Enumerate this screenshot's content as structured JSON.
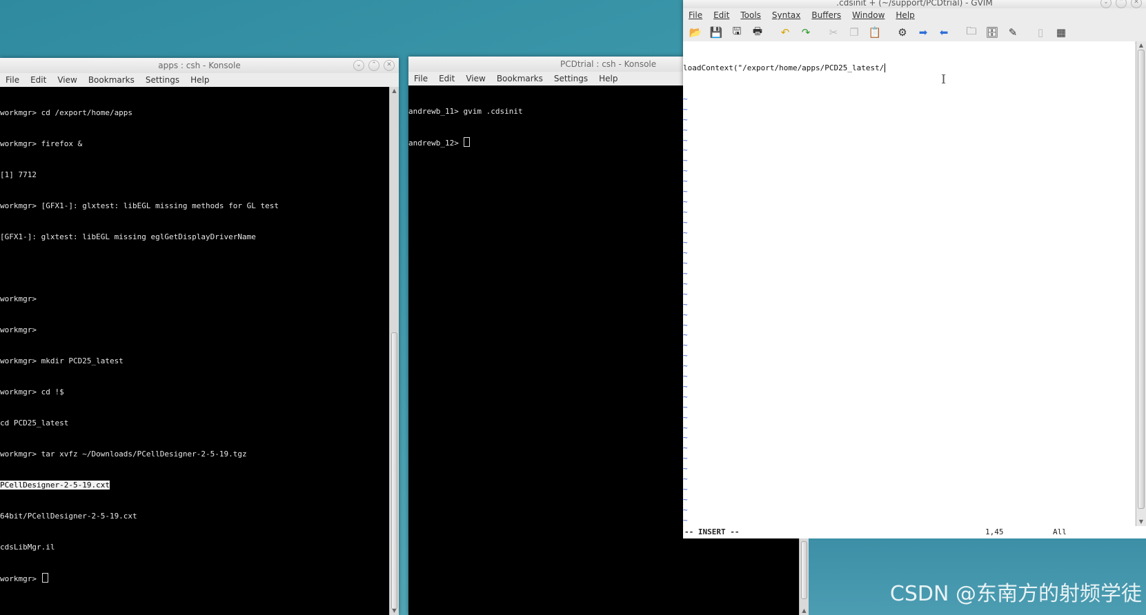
{
  "konsole_left": {
    "title": "apps : csh - Konsole",
    "menu": [
      "File",
      "Edit",
      "View",
      "Bookmarks",
      "Settings",
      "Help"
    ],
    "lines": [
      "workmgr> cd /export/home/apps",
      "workmgr> firefox &",
      "[1] 7712",
      "workmgr> [GFX1-]: glxtest: libEGL missing methods for GL test",
      "[GFX1-]: glxtest: libEGL missing eglGetDisplayDriverName",
      "",
      "workmgr>",
      "workmgr>",
      "workmgr> mkdir PCD25_latest",
      "workmgr> cd !$",
      "cd PCD25_latest",
      "workmgr> tar xvfz ~/Downloads/PCellDesigner-2-5-19.tgz"
    ],
    "selected_line": "PCellDesigner-2-5-19.cxt",
    "lines_after": [
      "64bit/PCellDesigner-2-5-19.cxt",
      "cdsLibMgr.il"
    ],
    "prompt": "workmgr> "
  },
  "konsole_middle": {
    "title": "PCDtrial : csh - Konsole",
    "menu": [
      "File",
      "Edit",
      "View",
      "Bookmarks",
      "Settings",
      "Help"
    ],
    "lines": [
      "andrewb_11> gvim .cdsinit"
    ],
    "prompt": "andrewb_12> "
  },
  "gvim": {
    "title": ".cdsinit + (~/support/PCDtrial) - GVIM",
    "menu": [
      "File",
      "Edit",
      "Tools",
      "Syntax",
      "Buffers",
      "Window",
      "Help"
    ],
    "toolbar_icons": [
      "open-icon",
      "save-icon",
      "save-all-icon",
      "print-icon",
      "undo-icon",
      "redo-icon",
      "cut-icon",
      "copy-icon",
      "paste-icon",
      "replace-icon",
      "find-next-icon",
      "find-prev-icon",
      "load-session-icon",
      "save-session-icon",
      "run-script-icon",
      "make-icon",
      "split-window-icon"
    ],
    "content_line": "loadContext(\"/export/home/apps/PCD25_latest/",
    "tilde": "~",
    "mode": "-- INSERT --",
    "position": "1,45",
    "scroll": "All"
  },
  "watermark": "CSDN @东南方的射频学徒"
}
